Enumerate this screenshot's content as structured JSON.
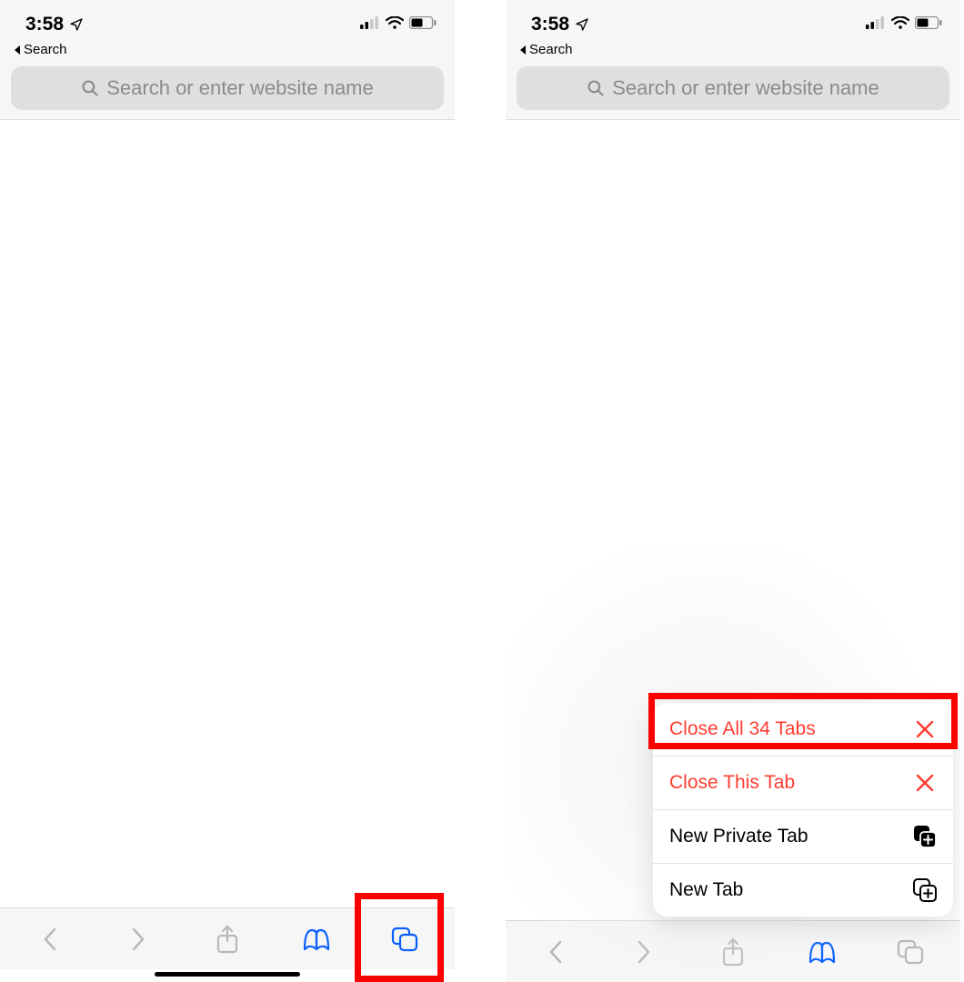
{
  "status": {
    "time": "3:58",
    "back_app_label": "Search"
  },
  "search": {
    "placeholder": "Search or enter website name"
  },
  "menu": {
    "close_all": "Close All 34 Tabs",
    "close_this": "Close This Tab",
    "new_private": "New Private Tab",
    "new_tab": "New Tab"
  },
  "icons": {
    "location": "location-arrow",
    "signal": "cell-signal",
    "wifi": "wifi",
    "battery": "battery-half",
    "search": "magnifying-glass",
    "back": "chevron-left",
    "forward": "chevron-right",
    "share": "share-square",
    "bookmarks": "open-book",
    "tabs": "stacked-squares",
    "close": "x-mark",
    "private_add": "square-plus-filled",
    "add": "square-plus-outline"
  },
  "colors": {
    "accent_blue": "#0a60ff",
    "destructive_red": "#ff3b30",
    "highlight_red": "#ff0000",
    "inactive_grey": "#b8b8bc"
  }
}
